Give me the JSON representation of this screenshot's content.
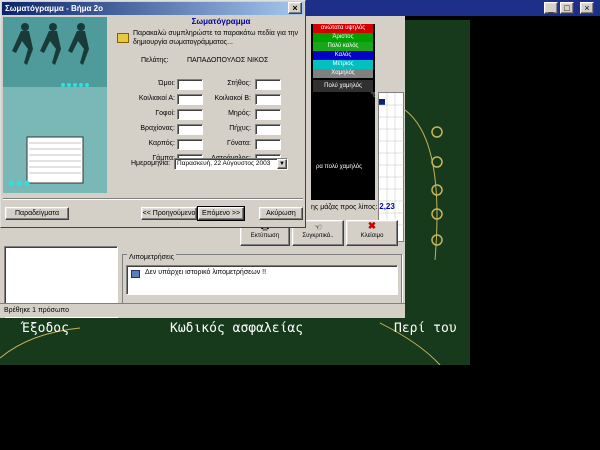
{
  "dialog": {
    "title": "Σωματόγραμμα - Βήμα 2ο",
    "heading": "Σωματόγραμμα",
    "instruction": "Παρακαλώ συμπληρώστε τα παρακάτω πεδία για την δημιουργία σωματογράμματος...",
    "client_label": "Πελάτης:",
    "client_name": "ΠΑΠΑΔΟΠΟΥΛΟΣ ΝΙΚΟΣ",
    "left_fields": [
      "Ώμοι:",
      "Κοιλιακοί Α:",
      "Γοφοί:",
      "Βραχίονας:",
      "Καρπός:",
      "Γάμπα:"
    ],
    "right_fields": [
      "Στήθος:",
      "Κοιλιακοί Β:",
      "Μηρός:",
      "Πήχυς:",
      "Γόνατα:",
      "Αστράγαλος:"
    ],
    "date_label": "Ημερομηνία:",
    "date_value": "Παρασκευή, 22  Αύγουστος  2003",
    "buttons": {
      "examples": "Παραδείγματα",
      "previous": "<< Προηγούμενο",
      "next": "Επόμενο >>",
      "cancel": "Ακύρωση"
    },
    "close_glyph": "×"
  },
  "legend": {
    "items": [
      {
        "label": "ανώτατα υψηλός",
        "color": "#d40000"
      },
      {
        "label": "Άριστος",
        "color": "#00a000"
      },
      {
        "label": "Πολύ καλός",
        "color": "#1aa61a"
      },
      {
        "label": "Καλός",
        "color": "#0000c8"
      },
      {
        "label": "Μέτριος",
        "color": "#00c0c0"
      },
      {
        "label": "Χαμηλός",
        "color": "#808080"
      }
    ],
    "very_low": "Πολύ χαμηλός",
    "very_low_2": "ρα πολύ χαμηλός"
  },
  "mass_label": "ης μάζας προς λίπος:",
  "mass_value": "2,23",
  "action_buttons": {
    "print": "Εκτύπωση",
    "compare": "Συγκριτικά..",
    "close": "Κλείσιμο"
  },
  "history": {
    "title": "Λιπομετρήσεις",
    "empty": "Δεν υπάρχει ιστορικό λιπομετρήσεων !!"
  },
  "status": "Βρέθηκε 1 πρόσωπο",
  "green": {
    "exit": "Έξοδος",
    "security": "Κωδικός ασφαλείας",
    "about": "Περί του"
  },
  "window_controls": {
    "min": "_",
    "max": "□",
    "close": "×"
  }
}
